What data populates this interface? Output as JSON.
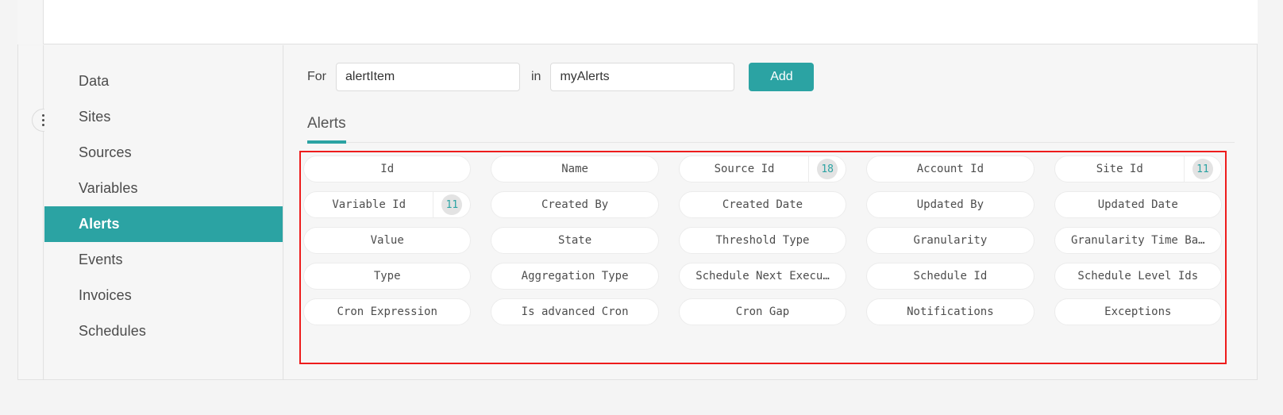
{
  "rail": {
    "menu_icon": "kebab-vertical-icon"
  },
  "sidebar": {
    "items": [
      {
        "label": "Data",
        "active": false
      },
      {
        "label": "Sites",
        "active": false
      },
      {
        "label": "Sources",
        "active": false
      },
      {
        "label": "Variables",
        "active": false
      },
      {
        "label": "Alerts",
        "active": true
      },
      {
        "label": "Events",
        "active": false
      },
      {
        "label": "Invoices",
        "active": false
      },
      {
        "label": "Schedules",
        "active": false
      }
    ]
  },
  "form": {
    "for_label": "For",
    "for_value": "alertItem",
    "for_placeholder": "",
    "in_label": "in",
    "in_value": "myAlerts",
    "in_placeholder": "",
    "add_label": "Add"
  },
  "tabs": [
    {
      "label": "Alerts",
      "active": true
    }
  ],
  "colors": {
    "accent_teal": "#2ba3a3",
    "annotation_red": "#ee1c1c",
    "badge_bg": "#e3e3e3",
    "panel_bg": "#f6f6f6",
    "chip_bg": "#ffffff"
  },
  "fields": [
    {
      "label": "Id",
      "badge": null
    },
    {
      "label": "Name",
      "badge": null
    },
    {
      "label": "Source Id",
      "badge": "18"
    },
    {
      "label": "Account Id",
      "badge": null
    },
    {
      "label": "Site Id",
      "badge": "11"
    },
    {
      "label": "Variable Id",
      "badge": "11"
    },
    {
      "label": "Created By",
      "badge": null
    },
    {
      "label": "Created Date",
      "badge": null
    },
    {
      "label": "Updated By",
      "badge": null
    },
    {
      "label": "Updated Date",
      "badge": null
    },
    {
      "label": "Value",
      "badge": null
    },
    {
      "label": "State",
      "badge": null
    },
    {
      "label": "Threshold Type",
      "badge": null
    },
    {
      "label": "Granularity",
      "badge": null
    },
    {
      "label": "Granularity Time Ba…",
      "badge": null
    },
    {
      "label": "Type",
      "badge": null
    },
    {
      "label": "Aggregation Type",
      "badge": null
    },
    {
      "label": "Schedule Next Execu…",
      "badge": null
    },
    {
      "label": "Schedule Id",
      "badge": null
    },
    {
      "label": "Schedule Level Ids",
      "badge": null
    },
    {
      "label": "Cron Expression",
      "badge": null
    },
    {
      "label": "Is advanced Cron",
      "badge": null
    },
    {
      "label": "Cron Gap",
      "badge": null
    },
    {
      "label": "Notifications",
      "badge": null
    },
    {
      "label": "Exceptions",
      "badge": null
    }
  ]
}
